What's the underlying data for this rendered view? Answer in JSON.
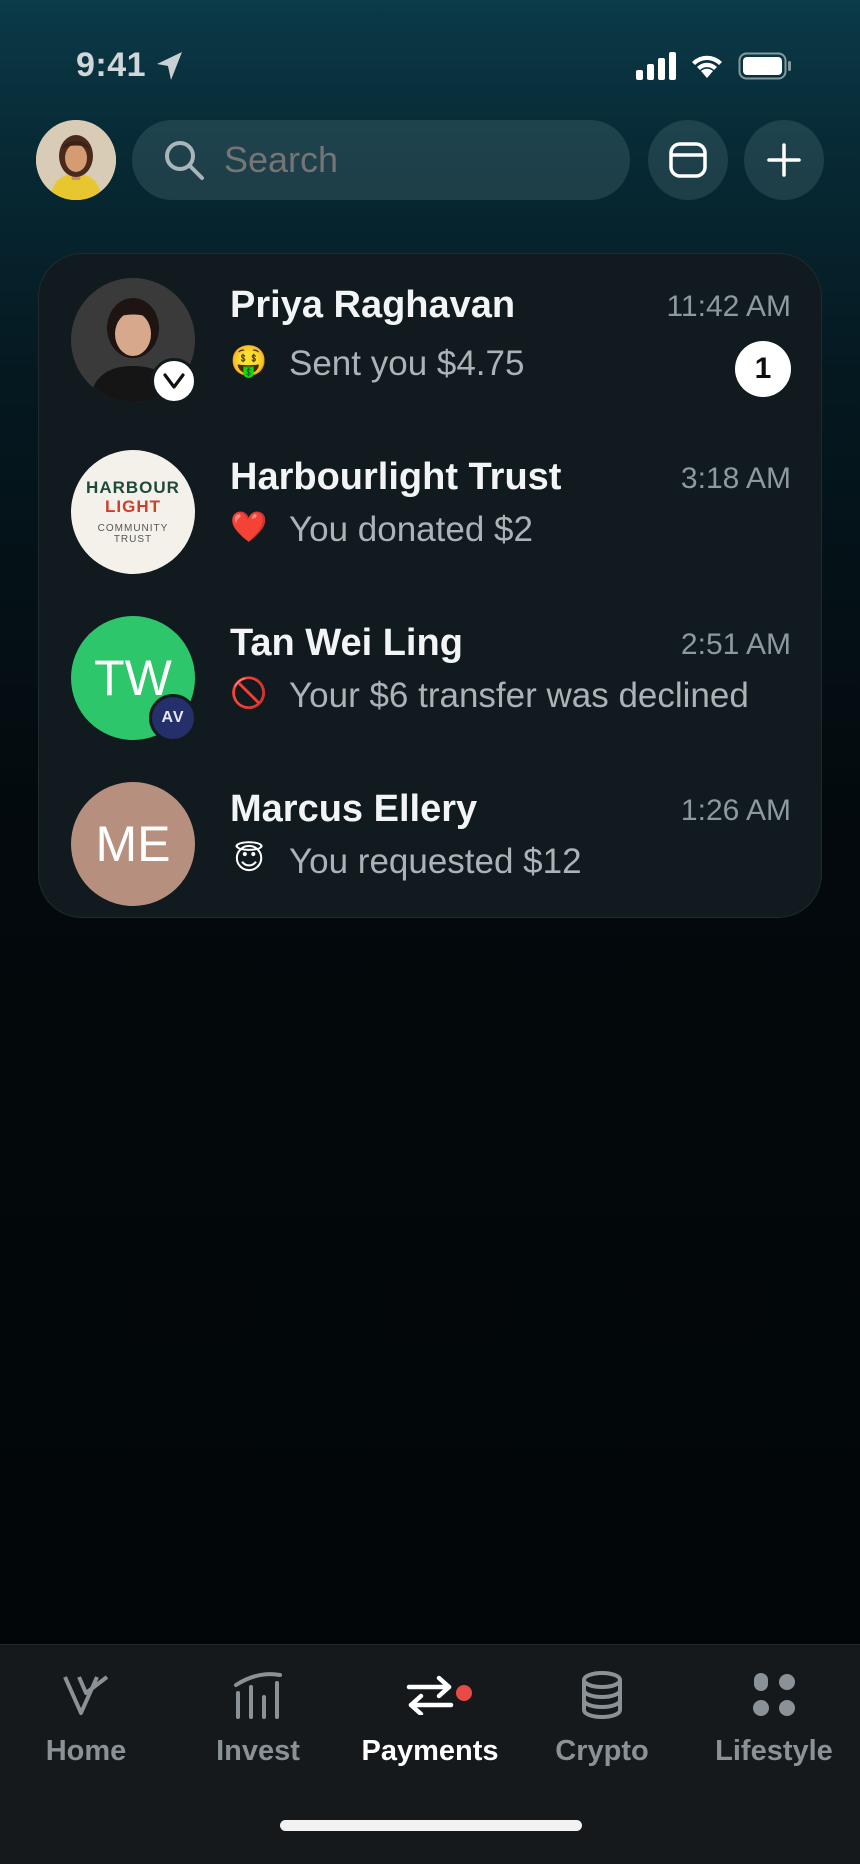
{
  "status_bar": {
    "time": "9:41"
  },
  "search": {
    "placeholder": "Search"
  },
  "conversations": [
    {
      "name": "Priya Raghavan",
      "time": "11:42 AM",
      "emoji": "🤑",
      "message": "Sent you $4.75",
      "unread_count": "1",
      "badge": "V"
    },
    {
      "name": "Harbourlight Trust",
      "time": "3:18 AM",
      "emoji": "❤️",
      "message": "You donated $2",
      "logo_lines": [
        "HARBOUR",
        "LIGHT",
        "COMMUNITY",
        "TRUST"
      ]
    },
    {
      "name": "Tan Wei Ling",
      "time": "2:51 AM",
      "emoji": "🚫",
      "message": "Your $6 transfer was declined",
      "initials": "TW",
      "badge": "AV",
      "avatar_color": "#2dc66a"
    },
    {
      "name": "Marcus Ellery",
      "time": "1:26 AM",
      "emoji": "😇",
      "message": "You requested $12",
      "initials": "ME",
      "avatar_color": "#b78f7f"
    }
  ],
  "nav": {
    "items": [
      {
        "label": "Home",
        "icon": "home-v-icon"
      },
      {
        "label": "Invest",
        "icon": "invest-bars-icon"
      },
      {
        "label": "Payments",
        "icon": "transfer-arrows-icon",
        "active": true
      },
      {
        "label": "Crypto",
        "icon": "crypto-coins-icon"
      },
      {
        "label": "Lifestyle",
        "icon": "lifestyle-dots-icon"
      }
    ]
  },
  "colors": {
    "accent_notification": "#e84a45",
    "card_bg": "#111a1e"
  }
}
